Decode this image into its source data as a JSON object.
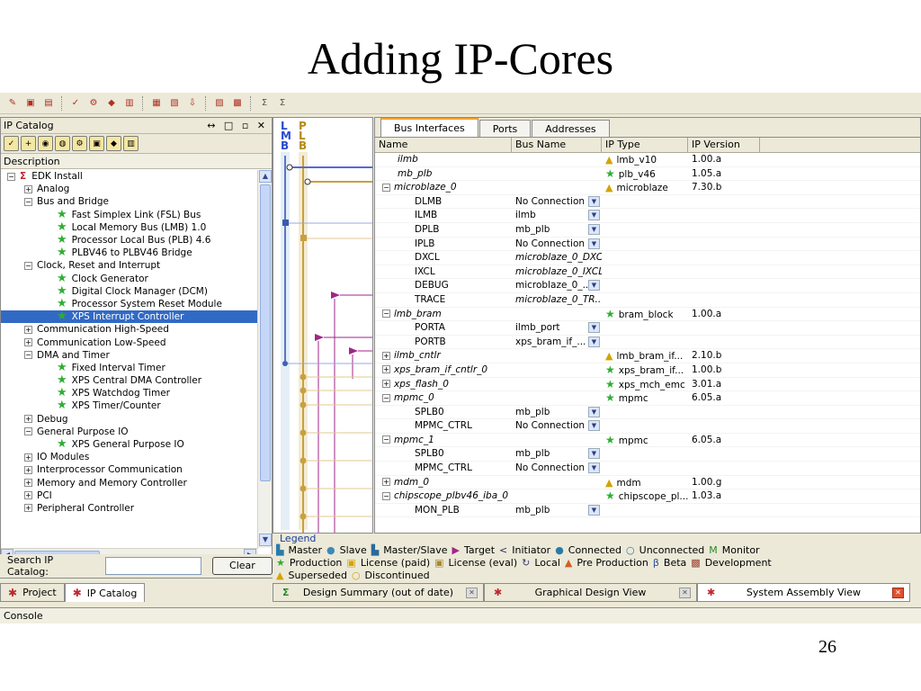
{
  "slide": {
    "title": "Adding IP-Cores",
    "page_number": "26"
  },
  "toolbar": {
    "icons": [
      "open-icon",
      "save-icon",
      "save-all-icon",
      "check-icon",
      "settings-icon",
      "diamond-icon",
      "bitstream-icon",
      "hardware-icon",
      "software-icon",
      "download-icon",
      "library-icon",
      "debug-icon",
      "sigma-icon",
      "sigma-alt-icon"
    ]
  },
  "ip_catalog": {
    "title": "IP Catalog",
    "panel_controls": "↔ □ ▫ ✕",
    "column_header": "Description",
    "tree": [
      {
        "label": "EDK Install",
        "depth": 0,
        "toggle": "−",
        "icon": "sigma"
      },
      {
        "label": "Analog",
        "depth": 1,
        "toggle": "+"
      },
      {
        "label": "Bus and Bridge",
        "depth": 1,
        "toggle": "−"
      },
      {
        "label": "Fast Simplex Link (FSL) Bus",
        "depth": 2,
        "icon": "star"
      },
      {
        "label": "Local Memory Bus (LMB) 1.0",
        "depth": 2,
        "icon": "star"
      },
      {
        "label": "Processor Local Bus (PLB) 4.6",
        "depth": 2,
        "icon": "star"
      },
      {
        "label": "PLBV46 to PLBV46 Bridge",
        "depth": 2,
        "icon": "star"
      },
      {
        "label": "Clock, Reset and Interrupt",
        "depth": 1,
        "toggle": "−"
      },
      {
        "label": "Clock Generator",
        "depth": 2,
        "icon": "star"
      },
      {
        "label": "Digital Clock Manager (DCM)",
        "depth": 2,
        "icon": "star"
      },
      {
        "label": "Processor System Reset Module",
        "depth": 2,
        "icon": "star"
      },
      {
        "label": "XPS Interrupt Controller",
        "depth": 2,
        "icon": "star",
        "selected": true
      },
      {
        "label": "Communication High-Speed",
        "depth": 1,
        "toggle": "+"
      },
      {
        "label": "Communication Low-Speed",
        "depth": 1,
        "toggle": "+"
      },
      {
        "label": "DMA and Timer",
        "depth": 1,
        "toggle": "−"
      },
      {
        "label": "Fixed Interval Timer",
        "depth": 2,
        "icon": "star"
      },
      {
        "label": "XPS Central DMA Controller",
        "depth": 2,
        "icon": "star"
      },
      {
        "label": "XPS Watchdog Timer",
        "depth": 2,
        "icon": "star"
      },
      {
        "label": "XPS Timer/Counter",
        "depth": 2,
        "icon": "star"
      },
      {
        "label": "Debug",
        "depth": 1,
        "toggle": "+"
      },
      {
        "label": "General Purpose IO",
        "depth": 1,
        "toggle": "−"
      },
      {
        "label": "XPS General Purpose IO",
        "depth": 2,
        "icon": "star"
      },
      {
        "label": "IO Modules",
        "depth": 1,
        "toggle": "+"
      },
      {
        "label": "Interprocessor Communication",
        "depth": 1,
        "toggle": "+"
      },
      {
        "label": "Memory and Memory Controller",
        "depth": 1,
        "toggle": "+"
      },
      {
        "label": "PCI",
        "depth": 1,
        "toggle": "+"
      },
      {
        "label": "Peripheral Controller",
        "depth": 1,
        "toggle": "+"
      }
    ],
    "search_label": "Search IP Catalog:",
    "search_value": "",
    "clear_label": "Clear"
  },
  "bottom_tabs": [
    {
      "label": "Project",
      "active": false
    },
    {
      "label": "IP Catalog",
      "active": true
    }
  ],
  "bus_strip": {
    "col1": [
      "L",
      "M",
      "B"
    ],
    "col2": [
      "P",
      "L",
      "B"
    ]
  },
  "assembly": {
    "tabs": [
      {
        "label": "Bus Interfaces",
        "active": true
      },
      {
        "label": "Ports",
        "active": false
      },
      {
        "label": "Addresses",
        "active": false
      }
    ],
    "columns": [
      "Name",
      "Bus Name",
      "IP Type",
      "IP Version"
    ],
    "rows": [
      {
        "name": "ilmb",
        "bus": "",
        "type": "lmb_v10",
        "version": "1.00.a",
        "level": 0,
        "italic": true,
        "icon": "warn"
      },
      {
        "name": "mb_plb",
        "bus": "",
        "type": "plb_v46",
        "version": "1.05.a",
        "level": 0,
        "italic": true,
        "icon": "star"
      },
      {
        "name": "microblaze_0",
        "bus": "",
        "type": "microblaze",
        "version": "7.30.b",
        "level": 0,
        "italic": true,
        "icon": "warn",
        "toggle": "−"
      },
      {
        "name": "DLMB",
        "bus": "No Connection",
        "type": "",
        "version": "",
        "level": 1,
        "dropdown": true
      },
      {
        "name": "ILMB",
        "bus": "ilmb",
        "type": "",
        "version": "",
        "level": 1,
        "dropdown": true
      },
      {
        "name": "DPLB",
        "bus": "mb_plb",
        "type": "",
        "version": "",
        "level": 1,
        "dropdown": true
      },
      {
        "name": "IPLB",
        "bus": "No Connection",
        "type": "",
        "version": "",
        "level": 1,
        "dropdown": true
      },
      {
        "name": "DXCL",
        "bus": "microblaze_0_DXCL",
        "type": "",
        "version": "",
        "level": 1,
        "bus_italic": true
      },
      {
        "name": "IXCL",
        "bus": "microblaze_0_IXCL",
        "type": "",
        "version": "",
        "level": 1,
        "bus_italic": true
      },
      {
        "name": "DEBUG",
        "bus": "microblaze_0_...",
        "type": "",
        "version": "",
        "level": 1,
        "dropdown": true
      },
      {
        "name": "TRACE",
        "bus": "microblaze_0_TR...",
        "type": "",
        "version": "",
        "level": 1,
        "bus_italic": true
      },
      {
        "name": "lmb_bram",
        "bus": "",
        "type": "bram_block",
        "version": "1.00.a",
        "level": 0,
        "italic": true,
        "icon": "star",
        "toggle": "−"
      },
      {
        "name": "PORTA",
        "bus": "ilmb_port",
        "type": "",
        "version": "",
        "level": 1,
        "dropdown": true
      },
      {
        "name": "PORTB",
        "bus": "xps_bram_if_...",
        "type": "",
        "version": "",
        "level": 1,
        "dropdown": true
      },
      {
        "name": "ilmb_cntlr",
        "bus": "",
        "type": "lmb_bram_if...",
        "version": "2.10.b",
        "level": 0,
        "italic": true,
        "icon": "warn",
        "toggle": "+"
      },
      {
        "name": "xps_bram_if_cntlr_0",
        "bus": "",
        "type": "xps_bram_if...",
        "version": "1.00.b",
        "level": 0,
        "italic": true,
        "icon": "star",
        "toggle": "+"
      },
      {
        "name": "xps_flash_0",
        "bus": "",
        "type": "xps_mch_emc",
        "version": "3.01.a",
        "level": 0,
        "italic": true,
        "icon": "star",
        "toggle": "+"
      },
      {
        "name": "mpmc_0",
        "bus": "",
        "type": "mpmc",
        "version": "6.05.a",
        "level": 0,
        "italic": true,
        "icon": "star",
        "toggle": "−"
      },
      {
        "name": "SPLB0",
        "bus": "mb_plb",
        "type": "",
        "version": "",
        "level": 1,
        "dropdown": true
      },
      {
        "name": "MPMC_CTRL",
        "bus": "No Connection",
        "type": "",
        "version": "",
        "level": 1,
        "dropdown": true
      },
      {
        "name": "mpmc_1",
        "bus": "",
        "type": "mpmc",
        "version": "6.05.a",
        "level": 0,
        "italic": true,
        "icon": "star",
        "toggle": "−"
      },
      {
        "name": "SPLB0",
        "bus": "mb_plb",
        "type": "",
        "version": "",
        "level": 1,
        "dropdown": true
      },
      {
        "name": "MPMC_CTRL",
        "bus": "No Connection",
        "type": "",
        "version": "",
        "level": 1,
        "dropdown": true
      },
      {
        "name": "mdm_0",
        "bus": "",
        "type": "mdm",
        "version": "1.00.g",
        "level": 0,
        "italic": true,
        "icon": "warn",
        "toggle": "+"
      },
      {
        "name": "chipscope_plbv46_iba_0",
        "bus": "",
        "type": "chipscope_pl...",
        "version": "1.03.a",
        "level": 0,
        "italic": true,
        "icon": "star",
        "toggle": "−"
      },
      {
        "name": "MON_PLB",
        "bus": "mb_plb",
        "type": "",
        "version": "",
        "level": 1,
        "dropdown": true
      }
    ]
  },
  "legend": {
    "title": "Legend",
    "line1": [
      {
        "icon": "▙",
        "color": "#2a7aa8",
        "label": "Master"
      },
      {
        "icon": "●",
        "color": "#3a8ab8",
        "label": "Slave"
      },
      {
        "icon": "▙",
        "color": "#2a6a98",
        "label": "Master/Slave"
      },
      {
        "icon": "▶",
        "color": "#a0268a",
        "label": "Target"
      },
      {
        "icon": "<",
        "color": "#303060",
        "label": "Initiator"
      },
      {
        "icon": "●",
        "color": "#2a7aa8",
        "label": "Connected"
      },
      {
        "icon": "○",
        "color": "#2a7aa8",
        "label": "Unconnected"
      },
      {
        "icon": "M",
        "color": "#2a8a2a",
        "label": "Monitor"
      }
    ],
    "line2": [
      {
        "icon": "★",
        "color": "#2fae32",
        "label": "Production"
      },
      {
        "icon": "▣",
        "color": "#d4a300",
        "label": "License (paid)"
      },
      {
        "icon": "▣",
        "color": "#a88a30",
        "label": "License (eval)"
      },
      {
        "icon": "↻",
        "color": "#404070",
        "label": "Local"
      },
      {
        "icon": "▲",
        "color": "#d06020",
        "label": "Pre Production"
      },
      {
        "icon": "β",
        "color": "#3050a0",
        "label": "Beta"
      },
      {
        "icon": "▩",
        "color": "#a04030",
        "label": "Development"
      }
    ],
    "line3": [
      {
        "icon": "▲",
        "color": "#d4a300",
        "label": "Superseded"
      },
      {
        "icon": "○",
        "color": "#d4a300",
        "label": "Discontinued"
      }
    ]
  },
  "design_tabs": [
    {
      "label": "Design Summary (out of date)",
      "icon": "Σ",
      "active": false
    },
    {
      "label": "Graphical Design View",
      "icon": "●",
      "active": false
    },
    {
      "label": "System Assembly View",
      "icon": "●",
      "active": true
    }
  ],
  "console": {
    "label": "Console"
  }
}
